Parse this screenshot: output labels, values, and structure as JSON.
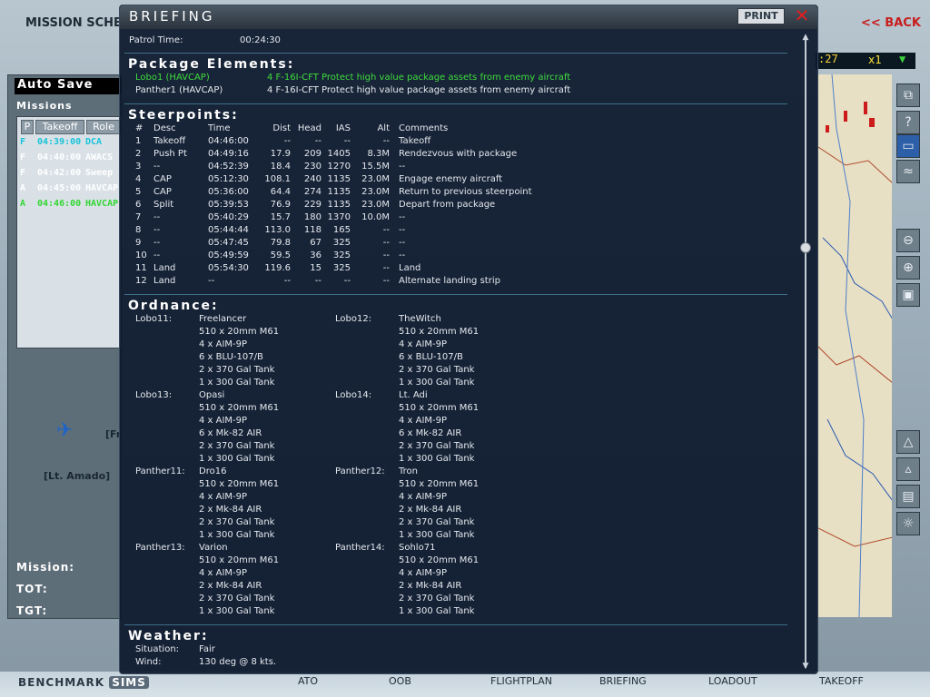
{
  "background": {
    "title": "MISSION SCHEDU",
    "back_label": "<< BACK",
    "autosave": "Auto Save",
    "missions_label": "Missions",
    "headers": [
      "P",
      "Takeoff",
      "Role"
    ],
    "missions": [
      {
        "p": "F",
        "time": "04:39:00",
        "role": "DCA",
        "color": "#17c3d8"
      },
      {
        "p": "F",
        "time": "04:40:00",
        "role": "AWACS",
        "color": "#ffffff"
      },
      {
        "p": "F",
        "time": "04:42:00",
        "role": "Sweep",
        "color": "#ffffff"
      },
      {
        "p": "A",
        "time": "04:45:00",
        "role": "HAVCAP",
        "color": "#ffffff"
      },
      {
        "p": "A",
        "time": "04:46:00",
        "role": "HAVCAP",
        "color": "#32d632"
      }
    ],
    "pilot_text": "[Lt. Amado]",
    "pilot_side": "[Fr",
    "mission_label": "Mission:",
    "tot_label": "TOT:",
    "tgt_label": "TGT:",
    "time_display": ":27",
    "time_scale": "x1",
    "logo_text": "BENCHMARK",
    "logo_badge": "SIMS",
    "nav": [
      "ATO",
      "OOB",
      "FLIGHTPLAN",
      "BRIEFING",
      "LOADOUT",
      "TAKEOFF"
    ]
  },
  "briefing": {
    "title": "Briefing",
    "print_label": "PRINT",
    "patrol_label": "Patrol Time:",
    "patrol_value": "00:24:30",
    "package_title": "Package Elements:",
    "package": [
      {
        "name": "Lobo1 (HAVCAP)",
        "desc": "4 F-16I-CFT Protect high value package assets from enemy aircraft",
        "highlight": true
      },
      {
        "name": "Panther1 (HAVCAP)",
        "desc": "4 F-16I-CFT Protect high value package assets from enemy aircraft",
        "highlight": false
      }
    ],
    "steerpoints_title": "Steerpoints:",
    "steer_headers": [
      "#",
      "Desc",
      "Time",
      "Dist",
      "Head",
      "IAS",
      "Alt",
      "Comments"
    ],
    "steerpoints": [
      [
        "1",
        "Takeoff",
        "04:46:00",
        "--",
        "--",
        "--",
        "--",
        "Takeoff"
      ],
      [
        "2",
        "Push Pt",
        "04:49:16",
        "17.9",
        "209",
        "1405",
        "8.3M",
        "Rendezvous with package"
      ],
      [
        "3",
        "--",
        "04:52:39",
        "18.4",
        "230",
        "1270",
        "15.5M",
        "--"
      ],
      [
        "4",
        "CAP",
        "05:12:30",
        "108.1",
        "240",
        "1135",
        "23.0M",
        "Engage enemy aircraft"
      ],
      [
        "5",
        "CAP",
        "05:36:00",
        "64.4",
        "274",
        "1135",
        "23.0M",
        "Return to previous steerpoint"
      ],
      [
        "6",
        "Split",
        "05:39:53",
        "76.9",
        "229",
        "1135",
        "23.0M",
        "Depart from package"
      ],
      [
        "7",
        "--",
        "05:40:29",
        "15.7",
        "180",
        "1370",
        "10.0M",
        "--"
      ],
      [
        "8",
        "--",
        "05:44:44",
        "113.0",
        "118",
        "165",
        "--",
        "--"
      ],
      [
        "9",
        "--",
        "05:47:45",
        "79.8",
        "67",
        "325",
        "--",
        "--"
      ],
      [
        "10",
        "--",
        "05:49:59",
        "59.5",
        "36",
        "325",
        "--",
        "--"
      ],
      [
        "11",
        "Land",
        "05:54:30",
        "119.6",
        "15",
        "325",
        "--",
        "Land"
      ],
      [
        "12",
        "Land",
        "--",
        "--",
        "--",
        "--",
        "--",
        "Alternate landing strip"
      ]
    ],
    "ordnance_title": "Ordnance:",
    "ordnance": [
      {
        "slot": "Lobo11:",
        "pilot": "Freelancer",
        "items": [
          "510 x 20mm M61",
          "4 x AIM-9P",
          "6 x BLU-107/B",
          "2 x 370 Gal Tank",
          "1 x 300 Gal Tank"
        ]
      },
      {
        "slot": "Lobo12:",
        "pilot": "TheWitch",
        "items": [
          "510 x 20mm M61",
          "4 x AIM-9P",
          "6 x BLU-107/B",
          "2 x 370 Gal Tank",
          "1 x 300 Gal Tank"
        ]
      },
      {
        "slot": "Lobo13:",
        "pilot": "Opasi",
        "items": [
          "510 x 20mm M61",
          "4 x AIM-9P",
          "6 x Mk-82 AIR",
          "2 x 370 Gal Tank",
          "1 x 300 Gal Tank"
        ]
      },
      {
        "slot": "Lobo14:",
        "pilot": "Lt. Adi",
        "items": [
          "510 x 20mm M61",
          "4 x AIM-9P",
          "6 x Mk-82 AIR",
          "2 x 370 Gal Tank",
          "1 x 300 Gal Tank"
        ]
      },
      {
        "slot": "Panther11:",
        "pilot": "Dro16",
        "items": [
          "510 x 20mm M61",
          "4 x AIM-9P",
          "2 x Mk-84 AIR",
          "2 x 370 Gal Tank",
          "1 x 300 Gal Tank"
        ]
      },
      {
        "slot": "Panther12:",
        "pilot": "Tron",
        "items": [
          "510 x 20mm M61",
          "4 x AIM-9P",
          "2 x Mk-84 AIR",
          "2 x 370 Gal Tank",
          "1 x 300 Gal Tank"
        ]
      },
      {
        "slot": "Panther13:",
        "pilot": "Varion",
        "items": [
          "510 x 20mm M61",
          "4 x AIM-9P",
          "2 x Mk-84 AIR",
          "2 x 370 Gal Tank",
          "1 x 300 Gal Tank"
        ]
      },
      {
        "slot": "Panther14:",
        "pilot": "Sohlo71",
        "items": [
          "510 x 20mm M61",
          "4 x AIM-9P",
          "2 x Mk-84 AIR",
          "2 x 370 Gal Tank",
          "1 x 300 Gal Tank"
        ]
      }
    ],
    "weather_title": "Weather:",
    "situation_label": "Situation:",
    "situation_value": "Fair",
    "wind_label": "Wind:",
    "wind_value": "130 deg @ 8 kts."
  }
}
